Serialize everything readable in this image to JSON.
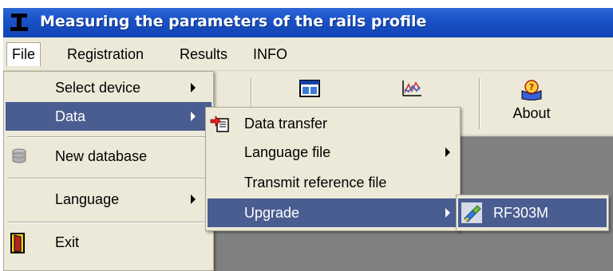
{
  "window": {
    "title": "Measuring the parameters of the rails profile"
  },
  "menubar": [
    {
      "label": "File"
    },
    {
      "label": "Registration"
    },
    {
      "label": "Results"
    },
    {
      "label": "INFO"
    }
  ],
  "toolbar": {
    "about_label": "About"
  },
  "file_menu": {
    "select_device": "Select device",
    "data": "Data",
    "new_database": "New database",
    "language": "Language",
    "exit": "Exit"
  },
  "data_menu": {
    "data_transfer": "Data transfer",
    "language_file": "Language file",
    "transmit_reference_file": "Transmit reference file",
    "upgrade": "Upgrade"
  },
  "upgrade_menu": {
    "device": "RF303M"
  },
  "colors": {
    "titlebar": "#1a52c7",
    "highlight": "#4a5d91",
    "workarea": "#808080",
    "menu_bg": "#ece9d8"
  }
}
